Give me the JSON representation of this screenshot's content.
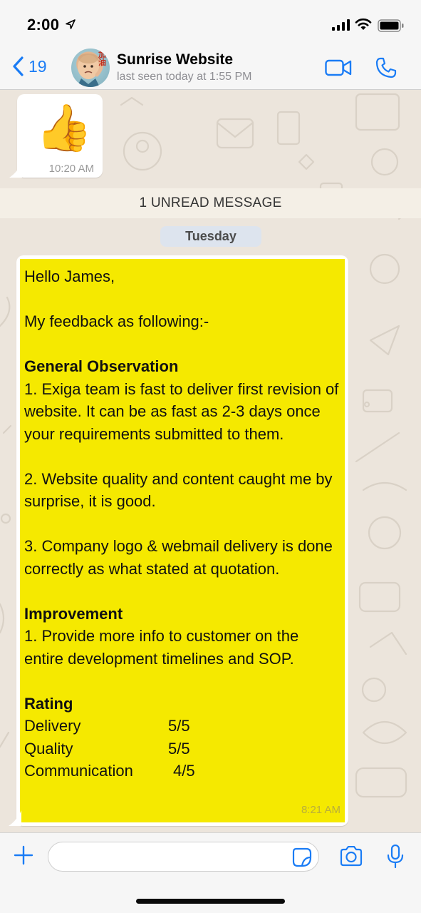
{
  "status_bar": {
    "time": "2:00"
  },
  "header": {
    "back_count": "19",
    "avatar_text": "加油",
    "contact_name": "Sunrise Website",
    "last_seen": "last seen today at 1:55 PM"
  },
  "chat": {
    "sticker": {
      "emoji": "👍",
      "time": "10:20 AM"
    },
    "unread_banner": "1 UNREAD MESSAGE",
    "day_label": "Tuesday",
    "message": {
      "greeting": "Hello James,",
      "intro": "My feedback as following:-",
      "section1_title": "General Observation",
      "obs1": "1. Exiga team is fast to deliver first revision of website. It can be as fast as 2-3 days once your requirements submitted to them.",
      "obs2": "2. Website quality and content caught me by surprise, it is good.",
      "obs3": "3. Company logo & webmail delivery is done correctly as what stated at quotation.",
      "section2_title": "Improvement",
      "imp1": "1. Provide more info to customer on the entire development timelines and SOP.",
      "section3_title": "Rating",
      "ratings": [
        {
          "label": "Delivery",
          "score": "5/5"
        },
        {
          "label": "Quality",
          "score": "5/5"
        },
        {
          "label": "Communication",
          "score": "4/5"
        }
      ],
      "time": "8:21 AM"
    }
  },
  "input": {
    "placeholder": ""
  },
  "colors": {
    "accent": "#1a7cf5",
    "highlight": "#f5e900",
    "chat_bg": "#ece5dc"
  }
}
